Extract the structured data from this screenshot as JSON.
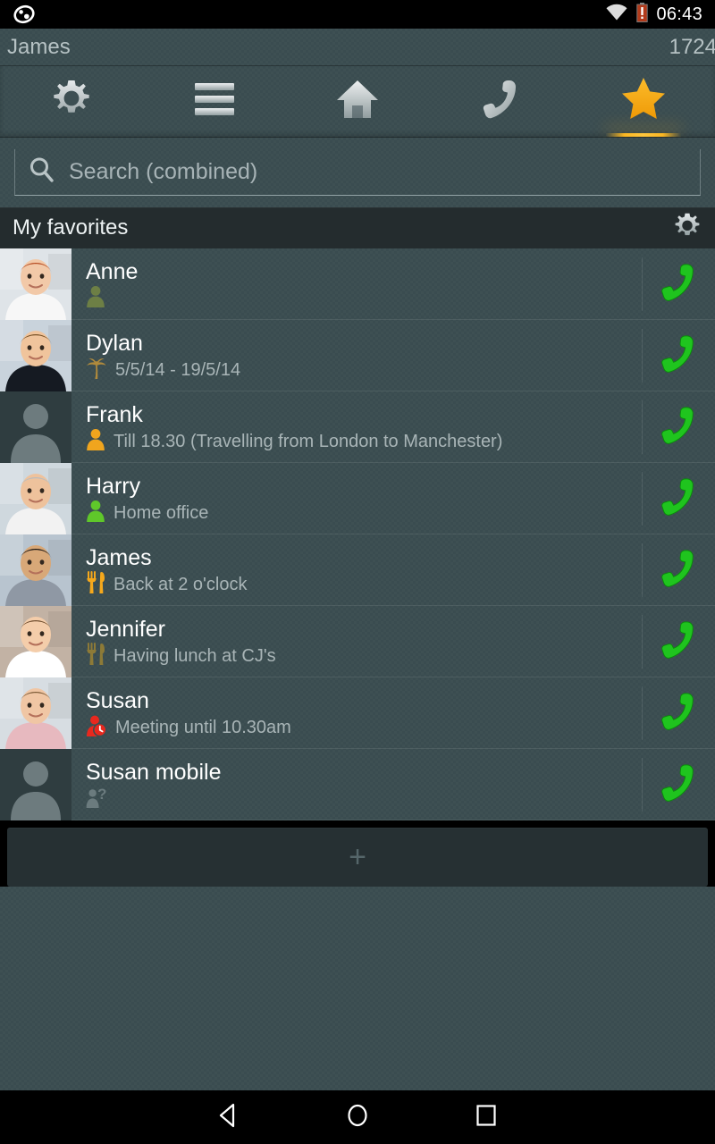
{
  "statusbar": {
    "notification_icon": "app-notification-icon",
    "wifi_icon": "wifi-icon",
    "battery_icon": "battery-low-icon",
    "time": "06:43"
  },
  "titlebar": {
    "user": "James",
    "extension": "1724"
  },
  "tabs": [
    {
      "icon": "gear-icon",
      "name": "settings",
      "selected": false
    },
    {
      "icon": "menu-icon",
      "name": "menu",
      "selected": false
    },
    {
      "icon": "home-icon",
      "name": "home",
      "selected": false
    },
    {
      "icon": "phone-icon",
      "name": "calls",
      "selected": false
    },
    {
      "icon": "star-icon",
      "name": "favorites",
      "selected": true
    }
  ],
  "search": {
    "icon": "search-icon",
    "placeholder": "Search (combined)",
    "value": ""
  },
  "section": {
    "title": "My favorites",
    "gear_icon": "gear-icon"
  },
  "contacts": [
    {
      "name": "Anne",
      "status_text": "",
      "status_icon": "person-icon",
      "status_color": "#6d7f45",
      "avatar": "photo",
      "call_icon": "phone-icon"
    },
    {
      "name": "Dylan",
      "status_text": "5/5/14 - 19/5/14",
      "status_icon": "palm-tree-icon",
      "status_color": "#b08a3c",
      "avatar": "photo",
      "call_icon": "phone-icon"
    },
    {
      "name": "Frank",
      "status_text": "Till 18.30 (Travelling from London to Manchester)",
      "status_icon": "person-icon",
      "status_color": "#f0a51e",
      "avatar": "placeholder",
      "call_icon": "phone-icon"
    },
    {
      "name": "Harry",
      "status_text": "Home office",
      "status_icon": "person-icon",
      "status_color": "#5fc72a",
      "avatar": "photo",
      "call_icon": "phone-icon"
    },
    {
      "name": "James",
      "status_text": "Back at 2 o'clock",
      "status_icon": "cutlery-icon",
      "status_color": "#f5a81c",
      "avatar": "photo",
      "call_icon": "phone-icon"
    },
    {
      "name": "Jennifer",
      "status_text": "Having lunch at CJ's",
      "status_icon": "cutlery-icon",
      "status_color": "#8d7a37",
      "avatar": "photo",
      "call_icon": "phone-icon"
    },
    {
      "name": "Susan",
      "status_text": "Meeting until 10.30am",
      "status_icon": "person-clock-icon",
      "status_color": "#e8281e",
      "avatar": "photo",
      "call_icon": "phone-icon"
    },
    {
      "name": "Susan mobile",
      "status_text": "",
      "status_icon": "person-question-icon",
      "status_color": "#6b7b7e",
      "avatar": "placeholder",
      "call_icon": "phone-icon"
    }
  ],
  "add_button": {
    "label": "+",
    "name": "add-favorite-button"
  },
  "navbar": {
    "back": "back-icon",
    "home": "home-icon",
    "recents": "recents-icon"
  },
  "colors": {
    "accent": "#f5a81c",
    "call_green": "#1dbd20",
    "background": "#3a4c50",
    "header_bg": "#242c2e"
  }
}
